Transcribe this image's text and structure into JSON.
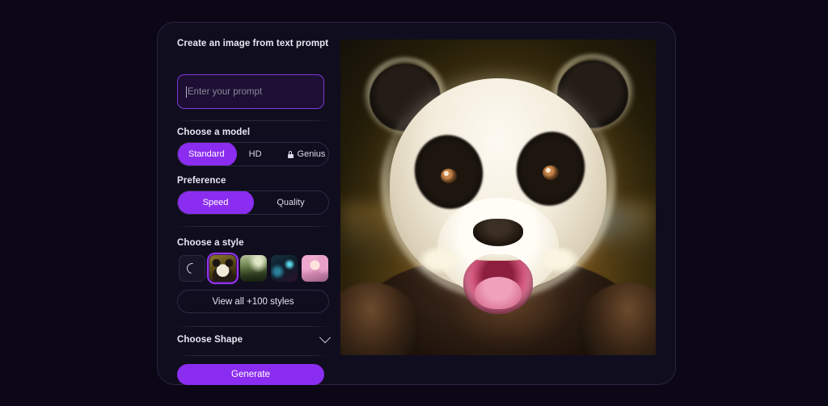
{
  "app": {
    "background_color": "#0b0716",
    "card_background": "#100d1e",
    "accent_color": "#8b2df0"
  },
  "prompt_section": {
    "title": "Create an image from text prompt",
    "input_placeholder": "Enter your prompt",
    "input_value": ""
  },
  "model_section": {
    "title": "Choose a model",
    "options": [
      {
        "label": "Standard",
        "selected": true,
        "locked": false
      },
      {
        "label": "HD",
        "selected": false,
        "locked": false
      },
      {
        "label": "Genius",
        "selected": false,
        "locked": true
      }
    ]
  },
  "preference_section": {
    "title": "Preference",
    "options": [
      {
        "label": "Speed",
        "selected": true
      },
      {
        "label": "Quality",
        "selected": false
      }
    ]
  },
  "style_section": {
    "title": "Choose a style",
    "thumbnails": [
      {
        "name": "no-style",
        "icon": "swirl-icon",
        "selected": false
      },
      {
        "name": "panda-style",
        "selected": true
      },
      {
        "name": "landscape-style",
        "selected": false
      },
      {
        "name": "cyberpunk-style",
        "selected": false
      },
      {
        "name": "anime-style",
        "selected": false
      }
    ],
    "view_all_label": "View all +100 styles"
  },
  "shape_section": {
    "title": "Choose Shape",
    "chevron": "chevron-down-icon"
  },
  "generate_button": {
    "label": "Generate"
  },
  "result": {
    "alt": "Generated image of a smiling panda"
  }
}
